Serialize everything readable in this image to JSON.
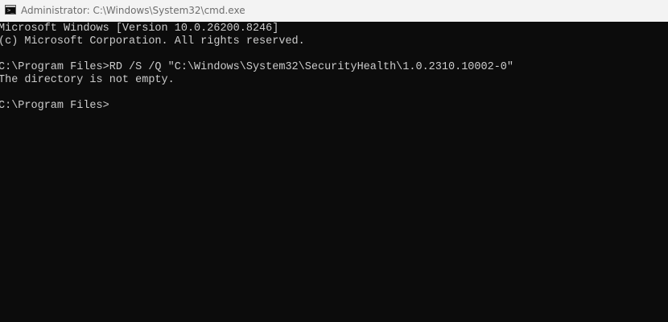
{
  "window": {
    "title": "Administrator: C:\\Windows\\System32\\cmd.exe",
    "icon": "cmd-icon"
  },
  "console": {
    "lines": [
      "Microsoft Windows [Version 10.0.26200.8246]",
      "(c) Microsoft Corporation. All rights reserved.",
      "",
      "C:\\Program Files>RD /S /Q \"C:\\Windows\\System32\\SecurityHealth\\1.0.2310.10002-0\"",
      "The directory is not empty.",
      "",
      "C:\\Program Files>"
    ]
  },
  "colors": {
    "background": "#0c0c0c",
    "text": "#cccccc",
    "titlebar": "#f3f3f3"
  }
}
